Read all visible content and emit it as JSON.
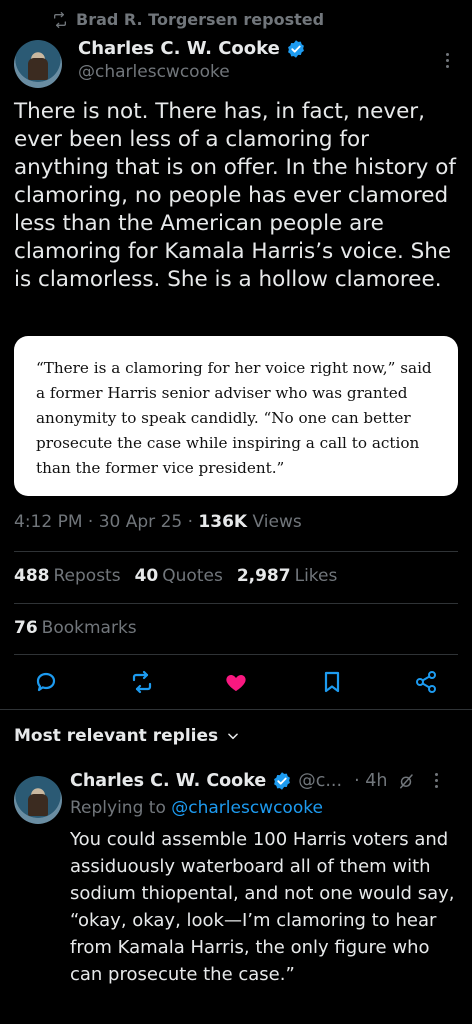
{
  "repost": {
    "text": "Brad R. Torgersen reposted"
  },
  "tweet": {
    "author_name": "Charles C. W. Cooke",
    "author_handle": "@charlescwcooke",
    "text": "There is not. There has, in fact, never, ever been less of a clamoring for anything that is on offer. In the history of clamoring, no people has ever clamored less than the American people are clamoring for Kamala Harris’s voice. She is clamorless. She is a hollow clamoree.",
    "quote": "“There is a clamoring for her voice right now,” said a former Harris senior adviser who was granted anonymity to speak candidly. “No one can better prosecute the case while inspiring a call to action than the former vice president.”",
    "time": "4:12 PM",
    "date": "30 Apr 25",
    "views_count": "136K",
    "views_label": "Views",
    "reposts_count": "488",
    "reposts_label": "Reposts",
    "quotes_count": "40",
    "quotes_label": "Quotes",
    "likes_count": "2,987",
    "likes_label": "Likes",
    "bookmarks_count": "76",
    "bookmarks_label": "Bookmarks"
  },
  "replies_header": "Most relevant replies",
  "reply": {
    "author_name": "Charles C. W. Cooke",
    "author_handle": "@c...",
    "age": "· 4h",
    "replying_prefix": "Replying to",
    "replying_handle": "@charlescwcooke",
    "text": "You could assemble 100 Harris voters and assiduously waterboard all of them with sodium thiopental, and not one would say, “okay, okay, look—I’m clamoring to hear from Kamala Harris, the only figure who can prosecute the case.”"
  },
  "colors": {
    "accent": "#1d9bf0",
    "like": "#f91880",
    "muted": "#71767b",
    "background": "#000000"
  },
  "icons": [
    "repost-icon",
    "verified-badge-icon",
    "more-icon",
    "reply-icon",
    "heart-icon",
    "bookmark-icon",
    "share-icon",
    "chevron-down-icon",
    "grok-icon"
  ]
}
